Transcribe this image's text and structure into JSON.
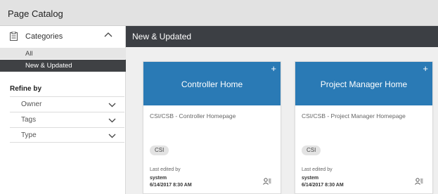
{
  "app": {
    "title": "Page Catalog"
  },
  "sidebar": {
    "categories_label": "Categories",
    "items": [
      {
        "label": "All"
      },
      {
        "label": "New & Updated"
      }
    ],
    "refine_label": "Refine by",
    "filters": [
      {
        "label": "Owner"
      },
      {
        "label": "Tags"
      },
      {
        "label": "Type"
      }
    ]
  },
  "main": {
    "section_title": "New & Updated",
    "cards": [
      {
        "title": "Controller Home",
        "description": "CSI/CSB - Controller Homepage",
        "tag": "CSI",
        "last_edited_label": "Last edited by",
        "user": "system",
        "date": "6/14/2017 8:30 AM",
        "add_symbol": "+"
      },
      {
        "title": "Project Manager Home",
        "description": "CSI/CSB - Project Manager Homepage",
        "tag": "CSI",
        "last_edited_label": "Last edited by",
        "user": "system",
        "date": "6/14/2017 8:30 AM",
        "add_symbol": "+"
      }
    ]
  },
  "colors": {
    "card_header": "#2a7ab5",
    "section_bar": "#3c3f44",
    "selected_nav": "#3f4144"
  },
  "icons": [
    "clipboard-icon",
    "chevron-up-icon",
    "chevron-down-icon",
    "plus-icon",
    "user-settings-icon"
  ]
}
